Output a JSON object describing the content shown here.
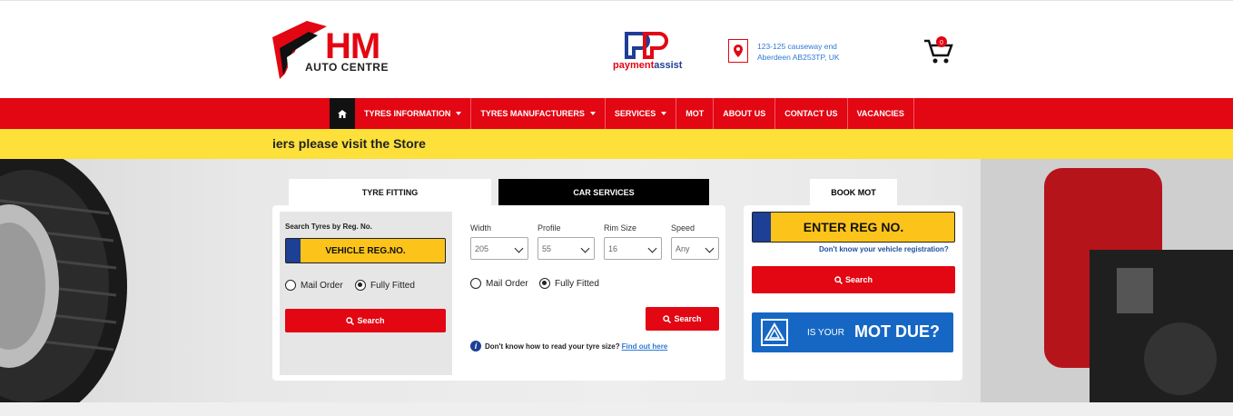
{
  "header": {
    "logo_main": "HM",
    "logo_sub": "AUTO CENTRE",
    "payment_brand_part1": "payment",
    "payment_brand_part2": "assist",
    "address_line1": "123-125 causeway end",
    "address_line2": "Aberdeen AB253TP, UK",
    "cart_count": "0"
  },
  "nav": {
    "items": [
      {
        "label": "TYRES INFORMATION",
        "dropdown": true
      },
      {
        "label": "TYRES MANUFACTURERS",
        "dropdown": true
      },
      {
        "label": "SERVICES",
        "dropdown": true
      },
      {
        "label": "MOT",
        "dropdown": false
      },
      {
        "label": "ABOUT US",
        "dropdown": false
      },
      {
        "label": "CONTACT US",
        "dropdown": false
      },
      {
        "label": "VACANCIES",
        "dropdown": false
      }
    ]
  },
  "ticker": {
    "text": "iers please visit the Store"
  },
  "tyre_search": {
    "tabs": [
      "TYRE FITTING",
      "CAR SERVICES"
    ],
    "reg_label": "Search Tyres by Reg. No.",
    "reg_plate": "VEHICLE REG.NO.",
    "radio_mail": "Mail Order",
    "radio_fitted": "Fully Fitted",
    "search_label": "Search",
    "size": {
      "width_label": "Width",
      "width_value": "205",
      "profile_label": "Profile",
      "profile_value": "55",
      "rim_label": "Rim Size",
      "rim_value": "16",
      "speed_label": "Speed",
      "speed_value": "Any"
    },
    "help_text": "Don't know how to read your tyre size?",
    "help_link": "Find out here"
  },
  "mot": {
    "tab": "BOOK MOT",
    "reg_plate": "ENTER REG NO.",
    "help_link": "Don't know your vehicle registration?",
    "search_label": "Search",
    "banner_small": "IS YOUR",
    "banner_big": "MOT DUE?"
  },
  "colors": {
    "brand_red": "#e30613",
    "ticker_yellow": "#fde03a",
    "plate_yellow": "#fcc41a",
    "mot_blue": "#1667c4"
  }
}
